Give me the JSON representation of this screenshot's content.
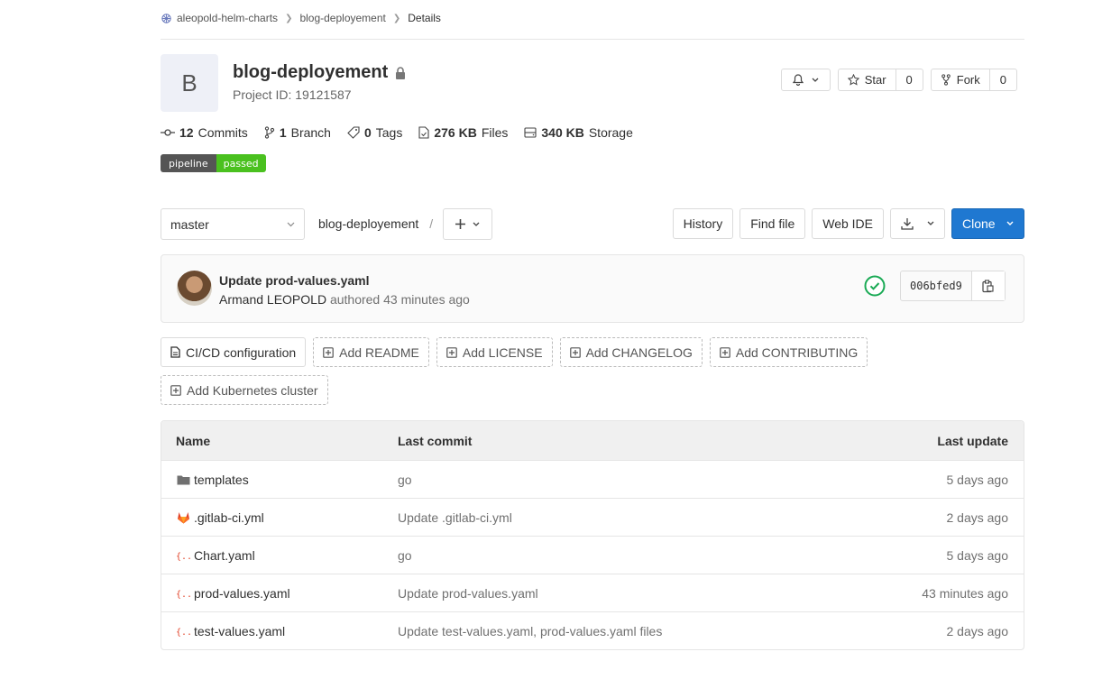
{
  "breadcrumb": {
    "group": "aleopold-helm-charts",
    "project": "blog-deployement",
    "current": "Details"
  },
  "project": {
    "avatar_letter": "B",
    "name": "blog-deployement",
    "id_text": "Project ID: 19121587"
  },
  "header_buttons": {
    "star_label": "Star",
    "star_count": "0",
    "fork_label": "Fork",
    "fork_count": "0"
  },
  "stats": [
    {
      "value": "12",
      "label": "Commits",
      "icon": "commit-icon"
    },
    {
      "value": "1",
      "label": "Branch",
      "icon": "branch-icon"
    },
    {
      "value": "0",
      "label": "Tags",
      "icon": "tag-icon"
    },
    {
      "value": "276 KB",
      "label": "Files",
      "icon": "file-icon"
    },
    {
      "value": "340 KB",
      "label": "Storage",
      "icon": "storage-icon"
    }
  ],
  "pipeline_badge": {
    "left": "pipeline",
    "right": "passed"
  },
  "tree": {
    "branch": "master",
    "path": "blog-deployement",
    "path_sep": "/",
    "history": "History",
    "find_file": "Find file",
    "web_ide": "Web IDE",
    "clone": "Clone"
  },
  "last_commit": {
    "title": "Update prod-values.yaml",
    "author": "Armand LEOPOLD",
    "authored": "authored 43 minutes ago",
    "sha": "006bfed9"
  },
  "quick_links": {
    "row1": [
      "CI/CD configuration",
      "Add README",
      "Add LICENSE",
      "Add CHANGELOG",
      "Add CONTRIBUTING"
    ],
    "row2": [
      "Add Kubernetes cluster"
    ]
  },
  "table": {
    "headers": {
      "name": "Name",
      "last_commit": "Last commit",
      "last_update": "Last update"
    },
    "rows": [
      {
        "name": "templates",
        "commit": "go",
        "updated": "5 days ago",
        "icon": "folder-icon"
      },
      {
        "name": ".gitlab-ci.yml",
        "commit": "Update .gitlab-ci.yml",
        "updated": "2 days ago",
        "icon": "gitlab-icon"
      },
      {
        "name": "Chart.yaml",
        "commit": "go",
        "updated": "5 days ago",
        "icon": "yaml-file-icon"
      },
      {
        "name": "prod-values.yaml",
        "commit": "Update prod-values.yaml",
        "updated": "43 minutes ago",
        "icon": "yaml-file-icon"
      },
      {
        "name": "test-values.yaml",
        "commit": "Update test-values.yaml, prod-values.yaml files",
        "updated": "2 days ago",
        "icon": "yaml-file-icon"
      }
    ]
  },
  "colors": {
    "primary": "#1f78d1",
    "pipeline_passed": "#4ac11f",
    "status_success": "#1aaa55",
    "yaml_icon": "#e24329"
  }
}
